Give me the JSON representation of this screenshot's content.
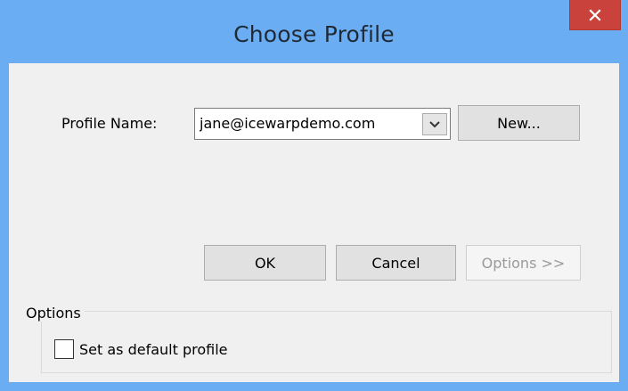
{
  "window": {
    "title": "Choose Profile",
    "close_icon": "close-icon"
  },
  "profile": {
    "label": "Profile Name:",
    "selected": "jane@icewarpdemo.com",
    "dropdown_icon": "chevron-down-icon"
  },
  "buttons": {
    "new": "New...",
    "ok": "OK",
    "cancel": "Cancel",
    "options": "Options >>"
  },
  "options_group": {
    "legend": "Options",
    "default_profile_label": "Set as default profile",
    "default_profile_checked": false
  },
  "colors": {
    "titlebar": "#6badf2",
    "close_button": "#c9423b",
    "client": "#f0f0f0"
  }
}
